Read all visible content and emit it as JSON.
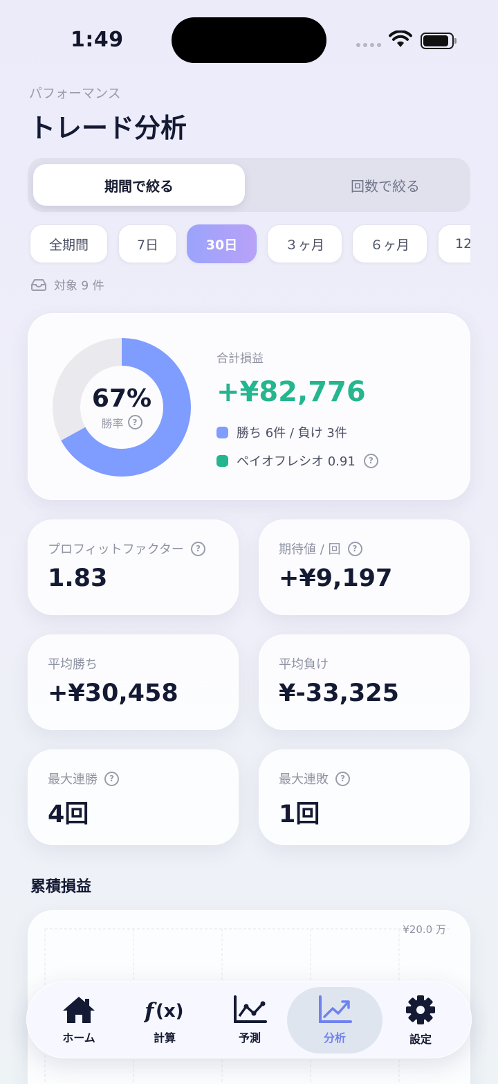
{
  "status": {
    "time": "1:49"
  },
  "header": {
    "eyebrow": "パフォーマンス",
    "title": "トレード分析"
  },
  "segmented": {
    "active": "期間で絞る",
    "inactive": "回数で絞る"
  },
  "periods": [
    "全期間",
    "7日",
    "30日",
    "３ヶ月",
    "６ヶ月",
    "12"
  ],
  "selected_period": "30日",
  "target_count": "対象 9 件",
  "summary": {
    "win_rate": "67%",
    "win_rate_fraction": 0.67,
    "win_rate_label": "勝率",
    "total_pl_label": "合計損益",
    "total_pl": "+¥82,776",
    "record": "勝ち 6件 / 負け 3件",
    "payoff": "ペイオフレシオ 0.91"
  },
  "metrics": {
    "profit_factor": {
      "label": "プロフィットファクター",
      "value": "1.83"
    },
    "expectancy": {
      "label": "期待値 / 回",
      "value": "+¥9,197"
    },
    "avg_win": {
      "label": "平均勝ち",
      "value": "+¥30,458"
    },
    "avg_loss": {
      "label": "平均負け",
      "value": "¥-33,325"
    },
    "max_win_streak": {
      "label": "最大連勝",
      "value": "4回"
    },
    "max_loss_streak": {
      "label": "最大連敗",
      "value": "1回"
    }
  },
  "cumulative": {
    "title": "累積損益",
    "y_max_label": "¥20.0 万"
  },
  "tabbar": {
    "home": "ホーム",
    "calc": "計算",
    "forecast": "予測",
    "analysis": "分析",
    "settings": "設定"
  },
  "colors": {
    "win": "#7f9cff",
    "loss": "#e9e9ee",
    "profit": "#25b58f",
    "accent": "#6f82ef"
  }
}
